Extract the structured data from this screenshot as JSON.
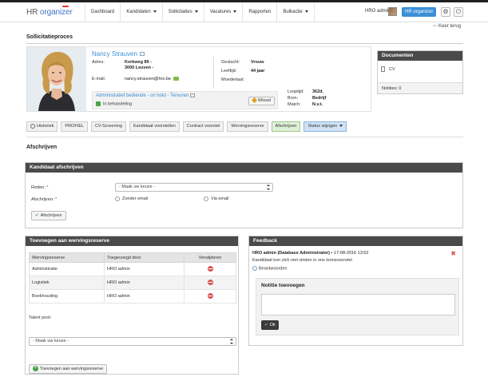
{
  "app": {
    "logo_part1": "HR ",
    "logo_part2": "organizer"
  },
  "nav": {
    "items": [
      {
        "label": "Dashboard",
        "has_caret": false
      },
      {
        "label": "Kandidaten",
        "has_caret": true
      },
      {
        "label": "Sollicitaties",
        "has_caret": true
      },
      {
        "label": "Vacatures",
        "has_caret": true
      },
      {
        "label": "Rapporten",
        "has_caret": false
      },
      {
        "label": "Bulkactie",
        "has_caret": true
      }
    ],
    "user_name": "HRO admin",
    "org_label": "HR organizer",
    "settings_icon": "gear-icon",
    "power_icon": "power-icon"
  },
  "page": {
    "title": "Sollicitatieproces",
    "back_label": "Keer terug"
  },
  "candidate": {
    "name": "Nancy Strauven",
    "address_label": "Adres:",
    "address_line1": "Kerkweg 89 -",
    "address_line2": "3000 Leuven -",
    "email_label": "E-mail:",
    "email": "nancy.strauven@hro.be",
    "gender_label": "Geslacht:",
    "gender": "Vrouw",
    "age_label": "Leeftijd:",
    "age": "44 jaar",
    "mother_tongue_label": "Moedertaal:",
    "mother_tongue": "",
    "duration_label": "Looptijd:",
    "duration": "362d.",
    "source_label": "Bron:",
    "source": "Bedrijf",
    "match_label": "Match:",
    "match": "N.v.t.",
    "vacancy_status": "Administratief bediende - on hold - Tervuren",
    "process_status": "In behandeling",
    "change_button": "Wissel"
  },
  "documents": {
    "title": "Documenten",
    "items": [
      "CV"
    ],
    "notes_label": "Notities: 0"
  },
  "steps": [
    {
      "label": "Historiek",
      "type": "history"
    },
    {
      "label": "PROFIEL",
      "type": "normal"
    },
    {
      "label": "CV-Screening",
      "type": "normal"
    },
    {
      "label": "Kandidaat voorstellen",
      "type": "normal"
    },
    {
      "label": "Contract voorstel",
      "type": "normal"
    },
    {
      "label": "Wervingsreserve",
      "type": "normal"
    },
    {
      "label": "Afschrijven",
      "type": "active"
    },
    {
      "label": "Status wijzigen",
      "type": "status"
    }
  ],
  "section": {
    "title": "Afschrijven"
  },
  "write_off": {
    "panel_title": "Kandidaat afschrijven",
    "reason_label": "Reden:",
    "reason_required": "*",
    "reason_selected": "- Maak uw keuze -",
    "write_off_label": "Afschrijven:",
    "write_off_required": "*",
    "option_no_email": "Zonder email",
    "option_email": "Via email",
    "submit_label": "Afschrijven"
  },
  "reserve": {
    "panel_title": "Toevoegen aan wervingsreserve",
    "columns": [
      "Wervingsreserve",
      "Toegevoegd door",
      "Verwijderen"
    ],
    "rows": [
      {
        "name": "Administratie",
        "added_by": "HRO admin"
      },
      {
        "name": "Logistiek",
        "added_by": "HRO admin"
      },
      {
        "name": "Boekhouding",
        "added_by": "HRO admin"
      }
    ],
    "talent_pool_label": "Talent pool:",
    "talent_pool_selected": "- Maak uw keuze -",
    "add_button": "Toevoegen aan wervingsreserve"
  },
  "feedback": {
    "panel_title": "Feedback",
    "author": "HRO admin (Database Administrator)",
    "date": "• 17-08-2016 13:52",
    "message": "Kandidaat kon zich niet vinden in ons loonsvoorstel",
    "reply_label": "Beantwoorden",
    "note_title": "Notitie toevoegen",
    "ok_label": "Ok"
  },
  "colors": {
    "accent": "#3a8fd6",
    "panel_header": "#4a4a4a",
    "success": "#46a546",
    "danger": "#d9534f"
  }
}
